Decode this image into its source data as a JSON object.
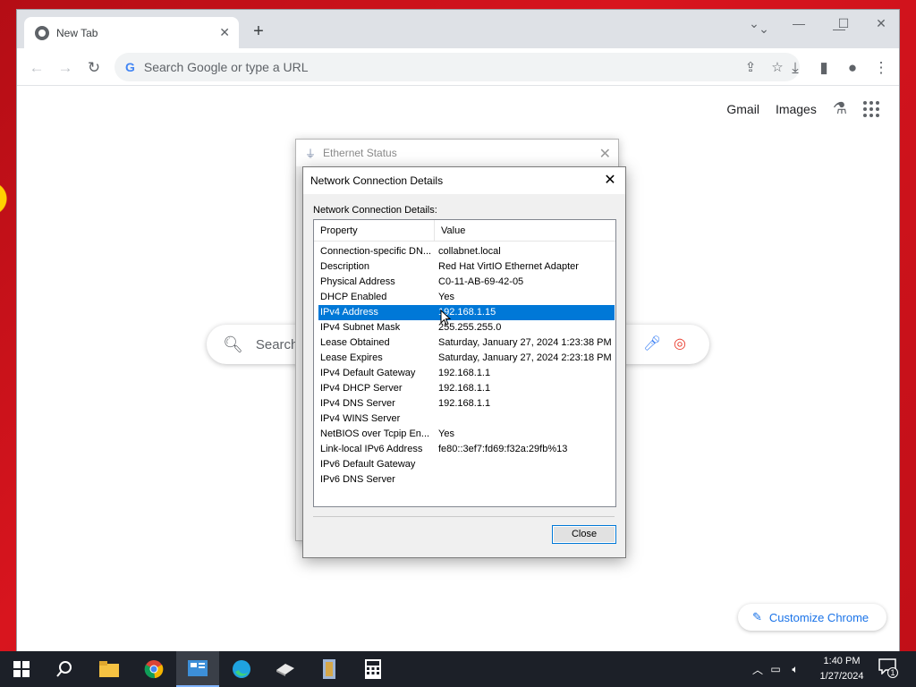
{
  "browser": {
    "tab_title": "New Tab",
    "omnibox_placeholder": "Search Google or type a URL",
    "google_letter": "G",
    "top_links": {
      "gmail": "Gmail",
      "images": "Images"
    },
    "search_placeholder": "Search",
    "customize_label": "Customize Chrome"
  },
  "ethernet_window": {
    "title": "Ethernet Status"
  },
  "dialog": {
    "title": "Network Connection Details",
    "label": "Network Connection Details:",
    "columns": {
      "property": "Property",
      "value": "Value"
    },
    "rows": [
      {
        "property": "Connection-specific DN...",
        "value": "collabnet.local"
      },
      {
        "property": "Description",
        "value": "Red Hat VirtIO Ethernet Adapter"
      },
      {
        "property": "Physical Address",
        "value": "C0-11-AB-69-42-05"
      },
      {
        "property": "DHCP Enabled",
        "value": "Yes"
      },
      {
        "property": "IPv4 Address",
        "value": "192.168.1.15",
        "selected": true
      },
      {
        "property": "IPv4 Subnet Mask",
        "value": "255.255.255.0"
      },
      {
        "property": "Lease Obtained",
        "value": "Saturday, January 27, 2024 1:23:38 PM"
      },
      {
        "property": "Lease Expires",
        "value": "Saturday, January 27, 2024 2:23:18 PM"
      },
      {
        "property": "IPv4 Default Gateway",
        "value": "192.168.1.1"
      },
      {
        "property": "IPv4 DHCP Server",
        "value": "192.168.1.1"
      },
      {
        "property": "IPv4 DNS Server",
        "value": "192.168.1.1"
      },
      {
        "property": "IPv4 WINS Server",
        "value": ""
      },
      {
        "property": "NetBIOS over Tcpip En...",
        "value": "Yes"
      },
      {
        "property": "Link-local IPv6 Address",
        "value": "fe80::3ef7:fd69:f32a:29fb%13"
      },
      {
        "property": "IPv6 Default Gateway",
        "value": ""
      },
      {
        "property": "IPv6 DNS Server",
        "value": ""
      }
    ],
    "close_label": "Close"
  },
  "taskbar": {
    "time": "1:40 PM",
    "date": "1/27/2024",
    "notification_count": "1"
  },
  "colors": {
    "selection": "#0078d7",
    "accent": "#1a73e8"
  }
}
